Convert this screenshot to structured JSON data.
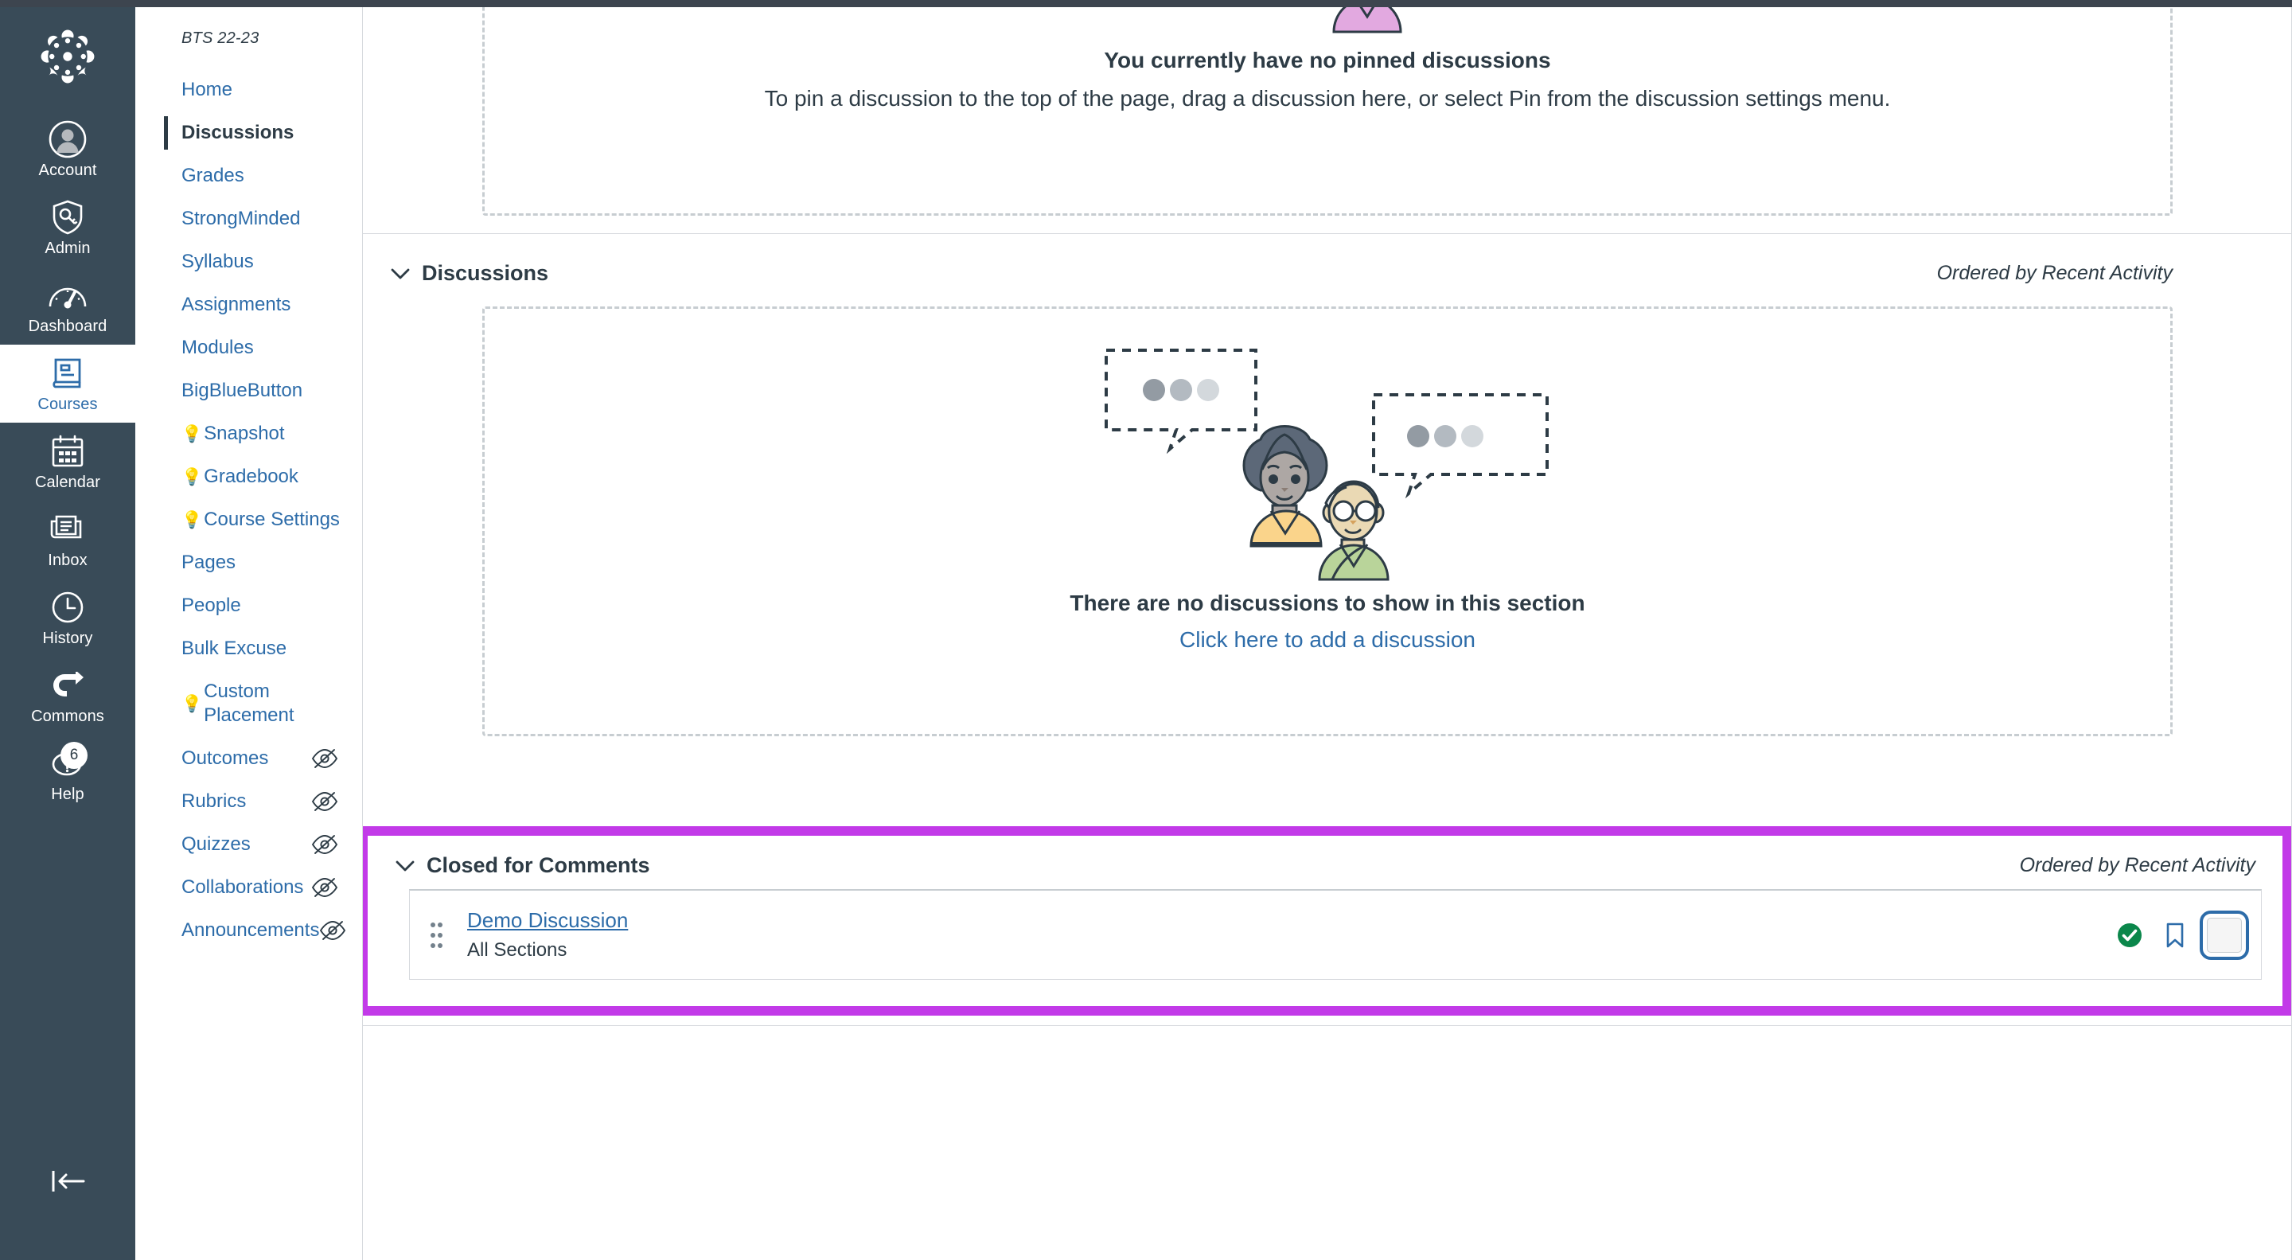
{
  "global_nav": {
    "logo": "canvas-logo",
    "items": [
      {
        "label": "Account",
        "icon": "account-avatar-icon",
        "active": false,
        "badge": null
      },
      {
        "label": "Admin",
        "icon": "shield-key-icon",
        "active": false,
        "badge": null
      },
      {
        "label": "Dashboard",
        "icon": "dashboard-gauge-icon",
        "active": false,
        "badge": null
      },
      {
        "label": "Courses",
        "icon": "book-icon",
        "active": true,
        "badge": null
      },
      {
        "label": "Calendar",
        "icon": "calendar-icon",
        "active": false,
        "badge": null
      },
      {
        "label": "Inbox",
        "icon": "inbox-tray-icon",
        "active": false,
        "badge": null
      },
      {
        "label": "History",
        "icon": "clock-icon",
        "active": false,
        "badge": null
      },
      {
        "label": "Commons",
        "icon": "commons-arrow-icon",
        "active": false,
        "badge": null
      },
      {
        "label": "Help",
        "icon": "question-circle-icon",
        "active": false,
        "badge": "6"
      }
    ],
    "collapse_label": "collapse-nav-icon"
  },
  "course_nav": {
    "course_code": "BTS 22-23",
    "items": [
      {
        "label": "Home",
        "active": false,
        "bulb": false,
        "hidden": false
      },
      {
        "label": "Discussions",
        "active": true,
        "bulb": false,
        "hidden": false
      },
      {
        "label": "Grades",
        "active": false,
        "bulb": false,
        "hidden": false
      },
      {
        "label": "StrongMinded",
        "active": false,
        "bulb": false,
        "hidden": false
      },
      {
        "label": "Syllabus",
        "active": false,
        "bulb": false,
        "hidden": false
      },
      {
        "label": "Assignments",
        "active": false,
        "bulb": false,
        "hidden": false
      },
      {
        "label": "Modules",
        "active": false,
        "bulb": false,
        "hidden": false
      },
      {
        "label": "BigBlueButton",
        "active": false,
        "bulb": false,
        "hidden": false
      },
      {
        "label": "Snapshot",
        "active": false,
        "bulb": true,
        "hidden": false
      },
      {
        "label": " Gradebook",
        "active": false,
        "bulb": true,
        "hidden": false
      },
      {
        "label": "Course Settings",
        "active": false,
        "bulb": true,
        "hidden": false
      },
      {
        "label": "Pages",
        "active": false,
        "bulb": false,
        "hidden": false
      },
      {
        "label": "People",
        "active": false,
        "bulb": false,
        "hidden": false
      },
      {
        "label": "Bulk Excuse",
        "active": false,
        "bulb": false,
        "hidden": false
      },
      {
        "label": "Custom Placement",
        "active": false,
        "bulb": true,
        "hidden": false
      },
      {
        "label": "Outcomes",
        "active": false,
        "bulb": false,
        "hidden": true
      },
      {
        "label": "Rubrics",
        "active": false,
        "bulb": false,
        "hidden": true
      },
      {
        "label": "Quizzes",
        "active": false,
        "bulb": false,
        "hidden": true
      },
      {
        "label": "Collaborations",
        "active": false,
        "bulb": false,
        "hidden": true
      },
      {
        "label": "Announcements",
        "active": false,
        "bulb": false,
        "hidden": true
      }
    ]
  },
  "main": {
    "pinned": {
      "title": "You currently have no pinned discussions",
      "subtitle": "To pin a discussion to the top of the page, drag a discussion here, or select Pin from the discussion settings menu."
    },
    "discussions_section": {
      "title": "Discussions",
      "order_label": "Ordered by Recent Activity",
      "empty_title": "There are no discussions to show in this section",
      "empty_link": "Click here to add a discussion"
    },
    "closed_section": {
      "title": "Closed for Comments",
      "order_label": "Ordered by Recent Activity",
      "rows": [
        {
          "title": "Demo Discussion",
          "sections": "All Sections",
          "published_icon": "published-check-icon",
          "subscribe_icon": "bookmark-icon",
          "menu_icon": "kebab-menu-icon"
        }
      ]
    }
  },
  "colors": {
    "highlight": "#c23ae8",
    "nav_dark": "#394b58",
    "link_blue": "#2d6ca9",
    "text_dark": "#2d3b45",
    "published_green": "#0b874b",
    "focus_blue": "#2d6ca9"
  }
}
